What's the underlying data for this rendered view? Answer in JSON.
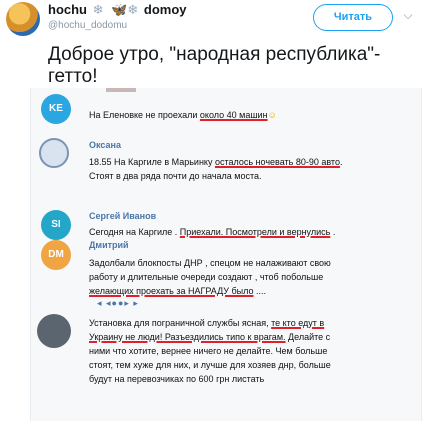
{
  "tweet": {
    "name": "hochu",
    "name_emoji_1": "❄",
    "name_emoji_2": "🦋❄",
    "name_second": "domoy",
    "handle": "@hochu_dodomu",
    "follow_label": "Читать",
    "caret": "⌵",
    "text": "Доброе утро, \"народная  республика\"-гетто!"
  },
  "comments": [
    {
      "avatar": "KE",
      "avatar_color": "#2aa6e0",
      "name": "",
      "text": "На Еленовке не проехали ",
      "underlined": "около 40 машин",
      "after": "",
      "smile": "☺"
    },
    {
      "avatar": "",
      "avatar_color": "#c8d6e5",
      "name": "Оксана",
      "text": "18.55 На Каргиле в Марьинку ",
      "underlined": "осталось ночевать 80-90 авто",
      "after": ".",
      "line2": "Стоят в два ряда почти до начала моста."
    },
    {
      "avatar": "SI",
      "avatar_color": "#24a6c9",
      "name": "Сергей Иванов",
      "text": "Сегодня на Каргиле . ",
      "underlined": "Приехали. Посмотрели и вернулись",
      "after": " ."
    },
    {
      "avatar": "DM",
      "avatar_color": "#f0a442",
      "name": "Дмитрий",
      "line1": "Задолбали блокпосты ДНР , спецом не налаживают свою",
      "line2": "работу и длительные очереди создают , чтоб побольше",
      "underlined": "желающих проехать за НАГРАДУ было",
      "after": " ...."
    },
    {
      "avatar": "",
      "avatar_color": "#5a6570",
      "name": "",
      "more_label": "◂ ◂●●▸ ▸",
      "line1_pre": "Установка для пограничной службы ясная, ",
      "line1_u": "те кто едут в",
      "line2_u": "Украину не люди! Разъездились типо к врагам.",
      "line2_post": " Делайте с",
      "line3": "ними что хотите, вернее ничего не делайте. Чем больше",
      "line4": "стоят, тем хуже для них, и лучше для хозяев днр, больше",
      "line5": "будут на перевозчиках по 600 грн листать"
    }
  ]
}
